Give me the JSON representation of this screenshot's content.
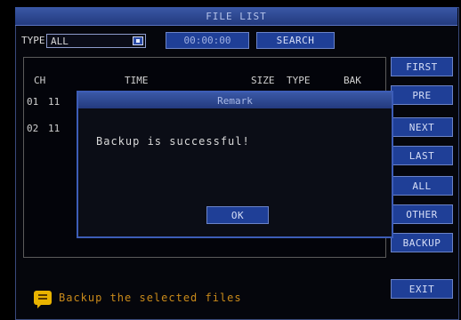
{
  "window": {
    "title": "FILE LIST"
  },
  "filter": {
    "type_label": "TYPE",
    "type_value": "ALL",
    "time_value": "00:00:00",
    "search_label": "SEARCH"
  },
  "list": {
    "headers": [
      "CH",
      "TIME",
      "SIZE",
      "TYPE",
      "BAK"
    ],
    "rows": [
      {
        "ch": "01",
        "time": "11"
      },
      {
        "ch": "02",
        "time": "11"
      }
    ]
  },
  "side_buttons": [
    "FIRST",
    "PRE",
    "NEXT",
    "LAST",
    "ALL",
    "OTHER",
    "BACKUP",
    "EXIT"
  ],
  "dialog": {
    "title": "Remark",
    "message": "Backup is successful!",
    "ok_label": "OK"
  },
  "status": {
    "tip": "Backup the selected files",
    "tip_icon": "message-icon"
  },
  "colors": {
    "accent": "#1f3f97",
    "title_bar": "#2b4690",
    "tip_text": "#c98a1a"
  }
}
